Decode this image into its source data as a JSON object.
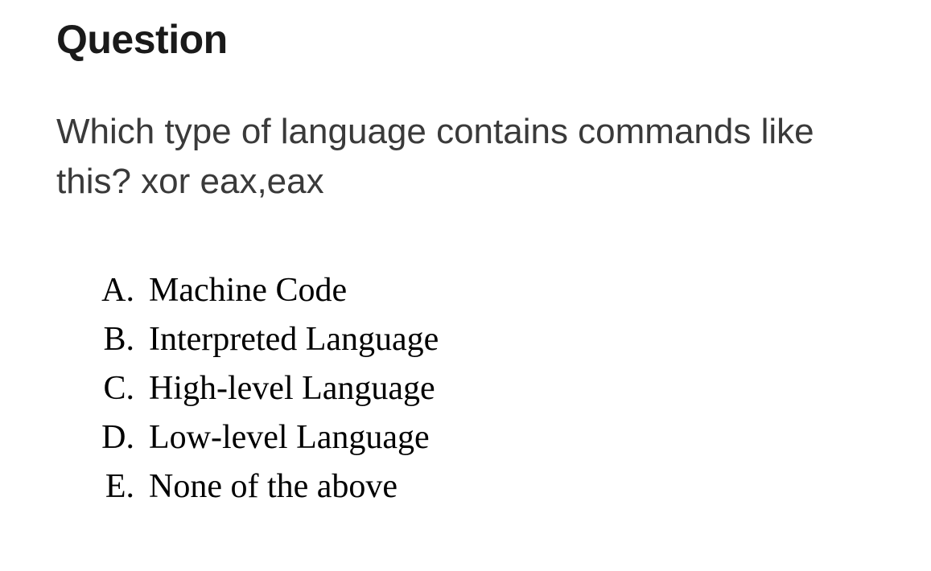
{
  "heading": "Question",
  "prompt": "Which type of language contains commands like this? xor eax,eax",
  "options": [
    {
      "letter": "A.",
      "text": "Machine Code"
    },
    {
      "letter": "B.",
      "text": "Interpreted Language"
    },
    {
      "letter": "C.",
      "text": "High-level Language"
    },
    {
      "letter": "D.",
      "text": "Low-level Language"
    },
    {
      "letter": "E.",
      "text": "None of the above"
    }
  ]
}
